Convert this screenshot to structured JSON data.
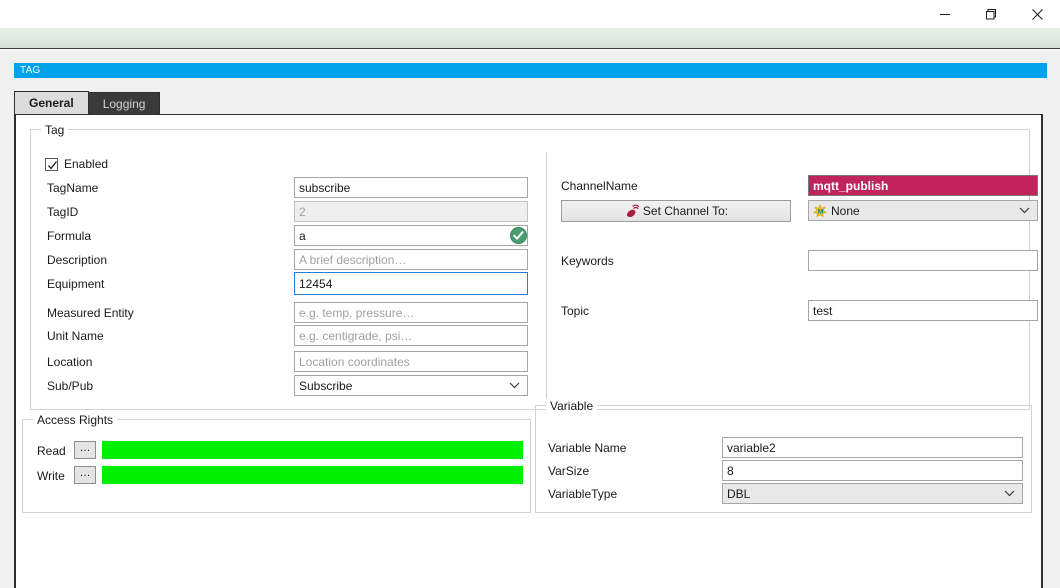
{
  "window": {
    "minimize_label": "—",
    "restore_label": "restore",
    "close_label": "✕"
  },
  "header": {
    "title": "TAG",
    "accent_color": "#00a2ec"
  },
  "tabs": [
    {
      "label": "General",
      "active": true
    },
    {
      "label": "Logging",
      "active": false
    }
  ],
  "tag_group": {
    "legend": "Tag",
    "enabled": {
      "label": "Enabled",
      "checked": true
    },
    "fields": [
      {
        "label": "TagName",
        "value": "subscribe",
        "placeholder": "",
        "state": "normal"
      },
      {
        "label": "TagID",
        "value": "2",
        "placeholder": "",
        "state": "readonly"
      },
      {
        "label": "Formula",
        "value": "a",
        "placeholder": "",
        "state": "valid"
      },
      {
        "label": "Description",
        "value": "",
        "placeholder": "A brief description…",
        "state": "normal"
      },
      {
        "label": "Equipment",
        "value": "12454",
        "placeholder": "",
        "state": "focus"
      },
      {
        "label": "Measured Entity",
        "value": "",
        "placeholder": "e.g. temp, pressure…",
        "state": "normal"
      },
      {
        "label": "Unit Name",
        "value": "",
        "placeholder": "e.g. centigrade, psi…",
        "state": "normal"
      },
      {
        "label": "Location",
        "value": "",
        "placeholder": "Location coordinates",
        "state": "normal"
      }
    ],
    "subpub": {
      "label": "Sub/Pub",
      "value": "Subscribe"
    },
    "channel": {
      "label": "ChannelName",
      "value": "mqtt_publish",
      "value_bg": "#c1245c",
      "set_channel_button": "Set Channel To:",
      "set_channel_icon": "signal-icon",
      "channel_select_value": "None",
      "channel_select_icon": "measurement-star-icon"
    },
    "keywords": {
      "label": "Keywords",
      "value": ""
    },
    "topic": {
      "label": "Topic",
      "value": "test"
    }
  },
  "access_rights": {
    "legend": "Access Rights",
    "rows": [
      {
        "label": "Read",
        "button": "…",
        "bar_color": "#00ee00"
      },
      {
        "label": "Write",
        "button": "…",
        "bar_color": "#00ee00"
      }
    ]
  },
  "variable": {
    "legend": "Variable",
    "name": {
      "label": "Variable Name",
      "value": "variable2"
    },
    "size": {
      "label": "VarSize",
      "value": "8"
    },
    "type": {
      "label": "VariableType",
      "value": "DBL"
    }
  }
}
